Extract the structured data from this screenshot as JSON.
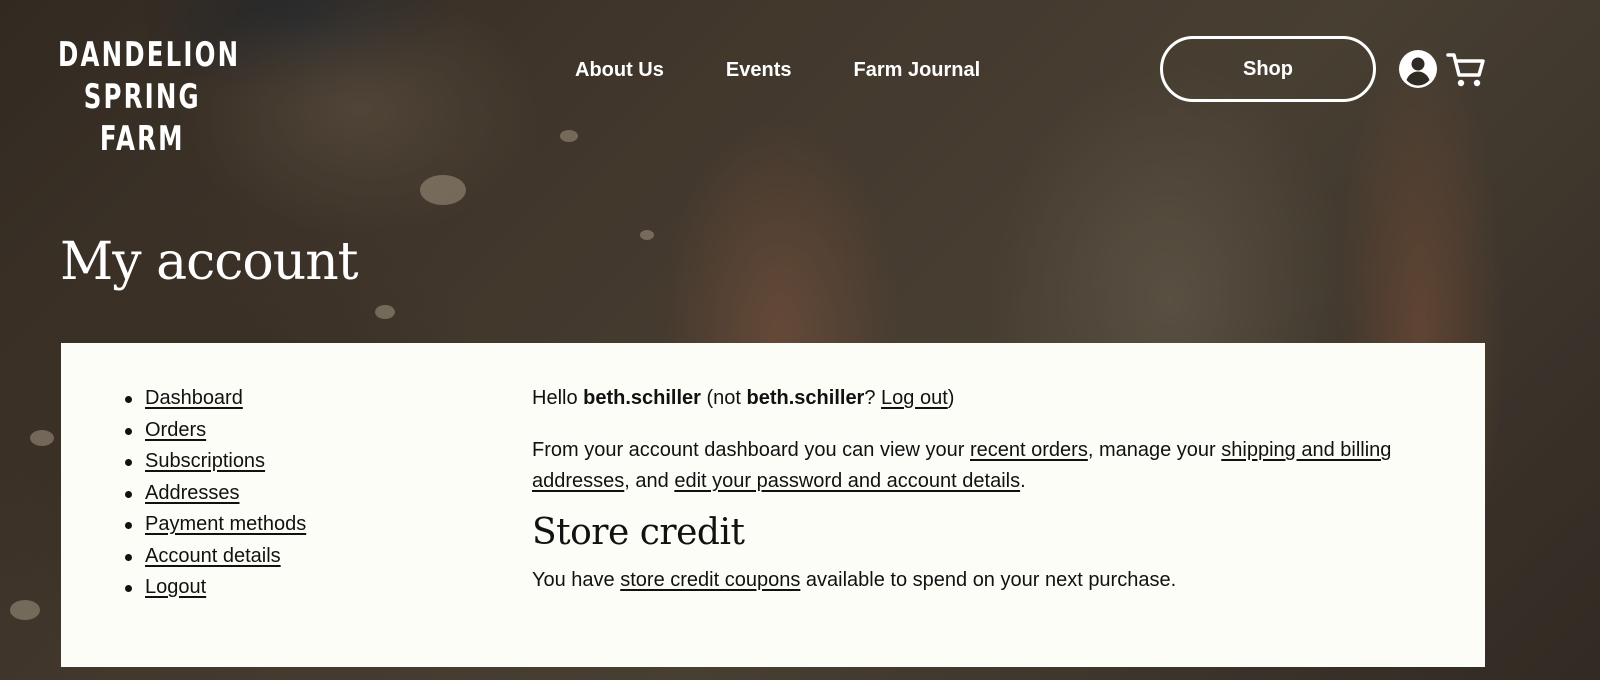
{
  "brand": {
    "logo_line1": "DANDELION",
    "logo_line2": "SPRING",
    "logo_line3": "FARM"
  },
  "nav": {
    "items": [
      {
        "label": "About Us"
      },
      {
        "label": "Events"
      },
      {
        "label": "Farm Journal"
      }
    ],
    "shop_label": "Shop",
    "account_icon": "account-circle-icon",
    "cart_icon": "cart-icon"
  },
  "page": {
    "title": "My account"
  },
  "account_nav": {
    "items": [
      {
        "label": "Dashboard"
      },
      {
        "label": "Orders"
      },
      {
        "label": "Subscriptions"
      },
      {
        "label": "Addresses"
      },
      {
        "label": "Payment methods"
      },
      {
        "label": "Account details"
      },
      {
        "label": "Logout"
      }
    ]
  },
  "dashboard": {
    "hello": "Hello ",
    "username": "beth.schiller",
    "not_prefix": " (not ",
    "username_repeat": "beth.schiller",
    "question": "? ",
    "logout_link": "Log out",
    "close_paren": ")",
    "intro_1": "From your account dashboard you can view your ",
    "recent_orders_link": "recent orders",
    "intro_2": ", manage your ",
    "addresses_link": "shipping and billing addresses",
    "intro_3": ", and ",
    "password_link": "edit your password and account details",
    "intro_4": "."
  },
  "store_credit": {
    "title": "Store credit",
    "text_1": "You have ",
    "coupons_link": "store credit coupons",
    "text_2": " available to spend on your next purchase."
  },
  "colors": {
    "card_background": "#fdfdf8",
    "text": "#111111",
    "header_text": "#ffffff"
  }
}
